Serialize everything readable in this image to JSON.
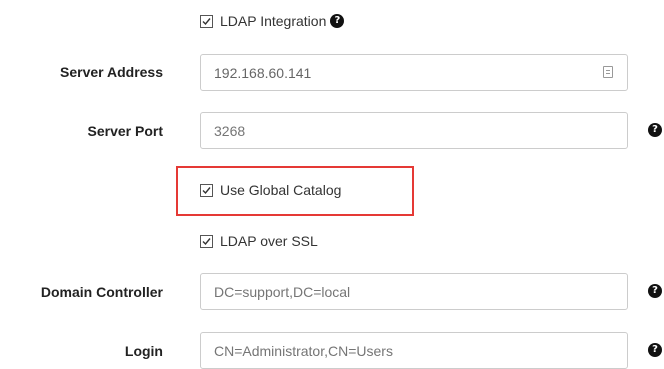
{
  "ldap_integration": {
    "label": "LDAP Integration",
    "checked": true,
    "help_icon": "question-circle-icon"
  },
  "server_address": {
    "label": "Server Address",
    "value": "192.168.60.141",
    "field_icon": "contact-card-icon"
  },
  "server_port": {
    "label": "Server Port",
    "placeholder": "3268",
    "help_icon": "question-circle-icon"
  },
  "use_global_catalog": {
    "label": "Use Global Catalog",
    "checked": true,
    "highlight_color": "#e53935"
  },
  "ldap_over_ssl": {
    "label": "LDAP over SSL",
    "checked": true
  },
  "domain_controller": {
    "label": "Domain Controller",
    "placeholder": "DC=support,DC=local",
    "help_icon": "question-circle-icon"
  },
  "login": {
    "label": "Login",
    "placeholder": "CN=Administrator,CN=Users",
    "help_icon": "question-circle-icon"
  }
}
